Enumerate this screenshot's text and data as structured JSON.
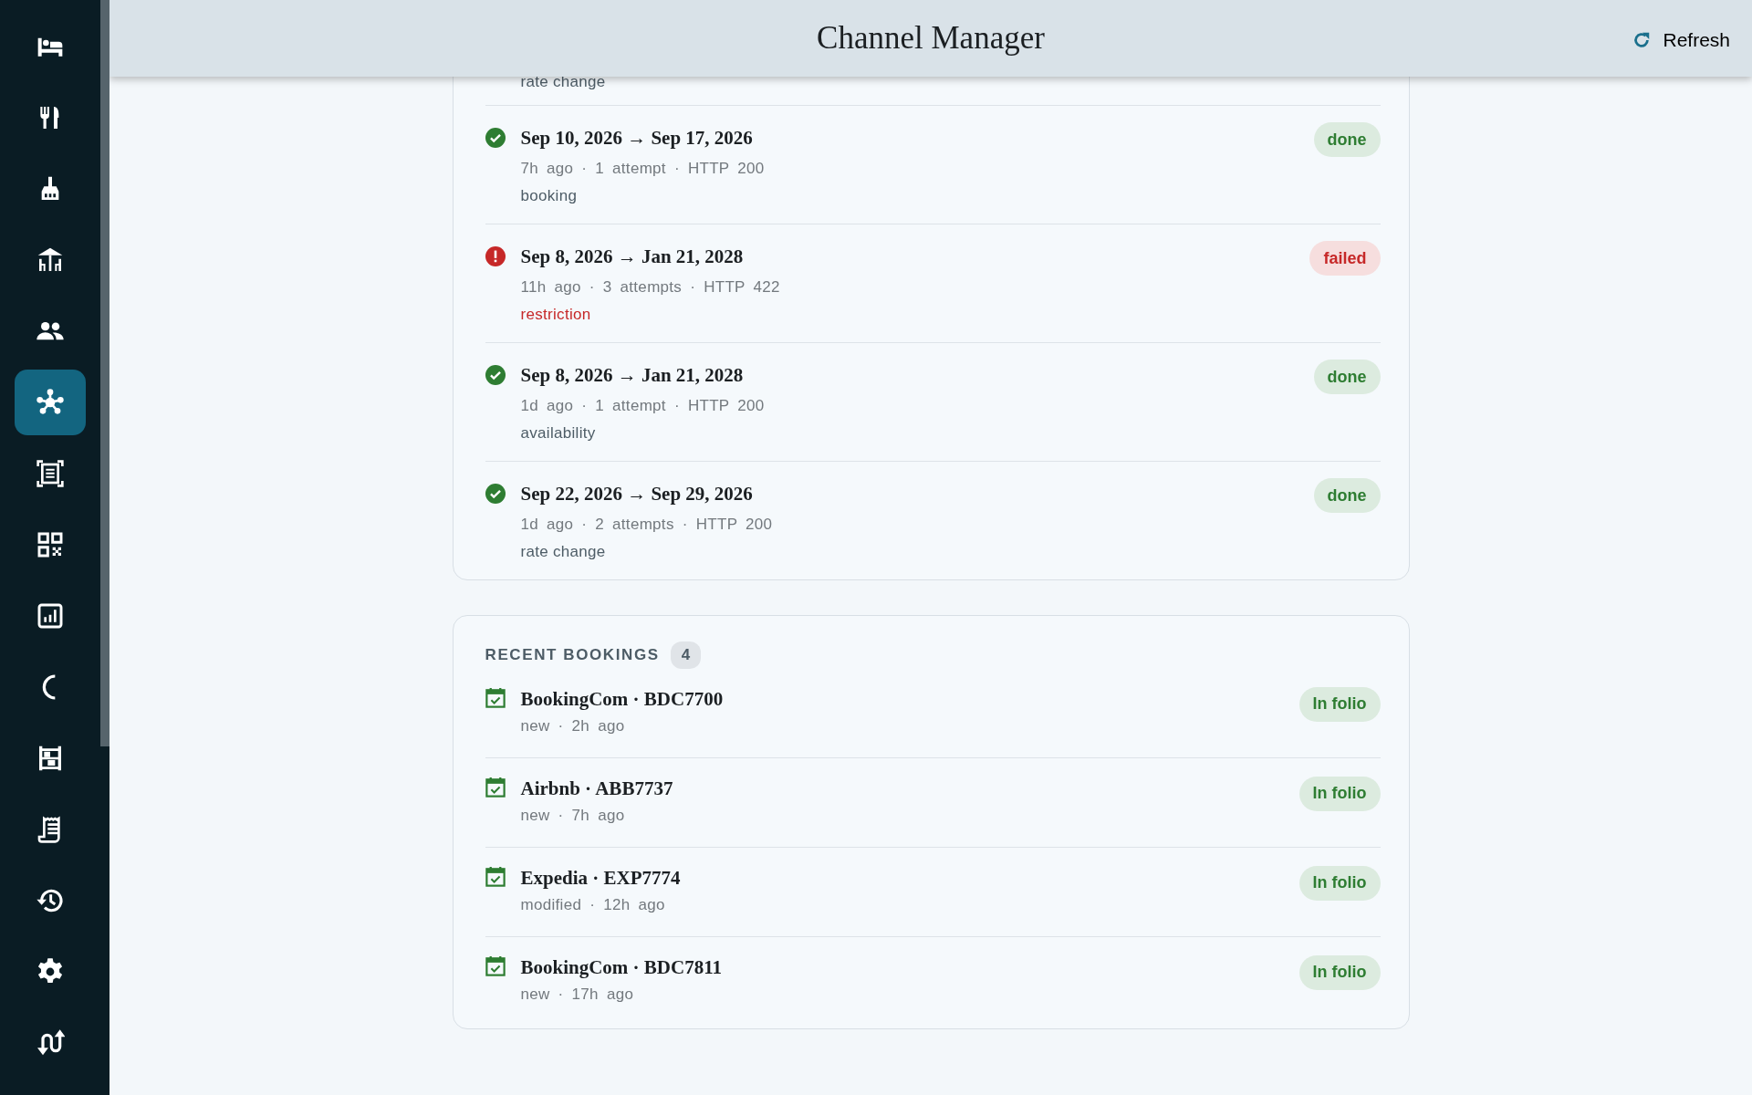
{
  "sidebar": {
    "items": [
      {
        "selected": false
      },
      {
        "selected": false
      },
      {
        "selected": false
      },
      {
        "selected": false
      },
      {
        "selected": false
      },
      {
        "selected": true
      },
      {
        "selected": false
      },
      {
        "selected": false
      },
      {
        "selected": false
      },
      {
        "selected": false
      },
      {
        "selected": false
      },
      {
        "selected": false
      },
      {
        "selected": false
      },
      {
        "selected": false
      },
      {
        "selected": false
      }
    ]
  },
  "header": {
    "title": "Channel Manager",
    "refresh_button": "Refresh"
  },
  "sync_jobs": {
    "items": [
      {
        "kind": "cut",
        "detail": "rate change"
      },
      {
        "kind": "ok",
        "title": "Sep 10, 2026 → Sep 17, 2026",
        "meta": "7h ago · 1 attempt · HTTP 200",
        "detail": "booking",
        "status": "done"
      },
      {
        "kind": "error",
        "title": "Sep 8, 2026 → Jan 21, 2028",
        "meta": "11h ago · 3 attempts · HTTP 422",
        "detail": "restriction",
        "status": "failed"
      },
      {
        "kind": "ok",
        "title": "Sep 8, 2026 → Jan 21, 2028",
        "meta": "1d ago · 1 attempt · HTTP 200",
        "detail": "availability",
        "status": "done"
      },
      {
        "kind": "ok",
        "title": "Sep 22, 2026 → Sep 29, 2026",
        "meta": "1d ago · 2 attempts · HTTP 200",
        "detail": "rate change",
        "status": "done"
      }
    ]
  },
  "recent_bookings": {
    "heading": "RECENT BOOKINGS",
    "count": "4",
    "items": [
      {
        "title": "BookingCom · BDC7700",
        "meta": "new · 2h ago",
        "status": "In folio"
      },
      {
        "title": "Airbnb · ABB7737",
        "meta": "new · 7h ago",
        "status": "In folio"
      },
      {
        "title": "Expedia · EXP7774",
        "meta": "modified · 12h ago",
        "status": "In folio"
      },
      {
        "title": "BookingCom · BDC7811",
        "meta": "new · 17h ago",
        "status": "In folio"
      }
    ]
  }
}
